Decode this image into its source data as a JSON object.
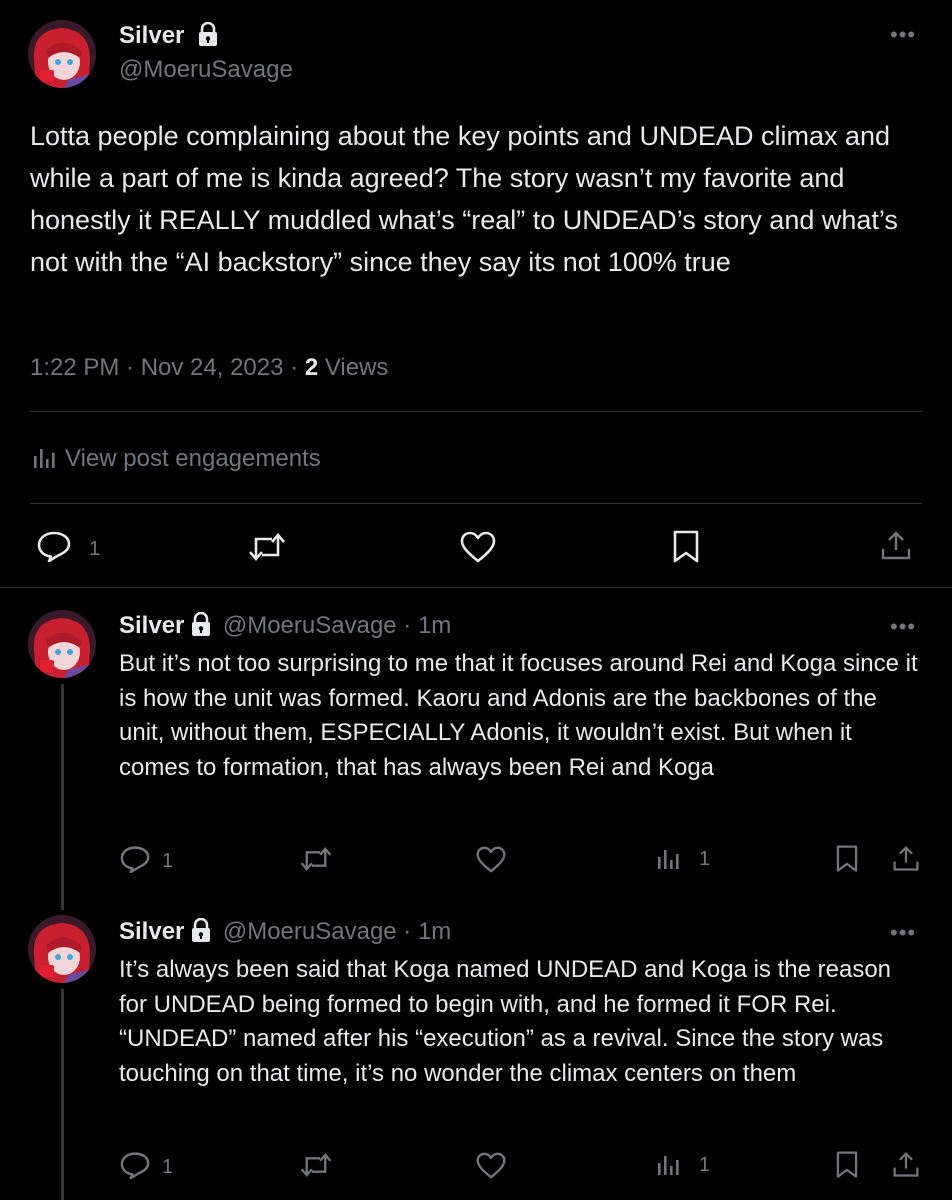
{
  "main_post": {
    "name": "Silver",
    "handle": "@MoeruSavage",
    "text": "Lotta people complaining about the key points and UNDEAD climax and while a part of me is kinda agreed? The story wasn’t my favorite and honestly it REALLY muddled what’s “real” to UNDEAD’s story and what’s not with the “AI backstory” since they say its not 100% true",
    "time": "1:22 PM · Nov 24, 2023 · ",
    "views_count": "2",
    "views_label": " Views",
    "engagements_label": "View post engagements",
    "reply_count": "1"
  },
  "replies": [
    {
      "name": "Silver",
      "handle": "@MoeruSavage · 1m",
      "text": "But it’s not too surprising to me that it focuses around Rei and Koga since it is how the unit was formed. Kaoru and Adonis are the backbones of the unit, without them, ESPECIALLY Adonis, it wouldn’t exist. But when it comes to formation, that has always been Rei and Koga",
      "reply_count": "1",
      "views_count": "1"
    },
    {
      "name": "Silver",
      "handle": "@MoeruSavage · 1m",
      "text": "It’s always been said that Koga named UNDEAD and Koga is the reason for UNDEAD being formed to begin with, and he formed it FOR Rei. “UNDEAD” named after his “execution” as a revival. Since the story was touching on that time, it’s no wonder the climax centers on them",
      "reply_count": "1",
      "views_count": "1"
    }
  ],
  "icons": {
    "more": "more-options-icon",
    "lock": "lock-icon",
    "reply": "reply-icon",
    "repost": "repost-icon",
    "like": "like-icon",
    "bookmark": "bookmark-icon",
    "share": "share-icon",
    "analytics": "analytics-icon"
  },
  "colors": {
    "background": "#000000",
    "text": "#e7e9ea",
    "muted": "#71767b",
    "divider": "#2f3336"
  }
}
